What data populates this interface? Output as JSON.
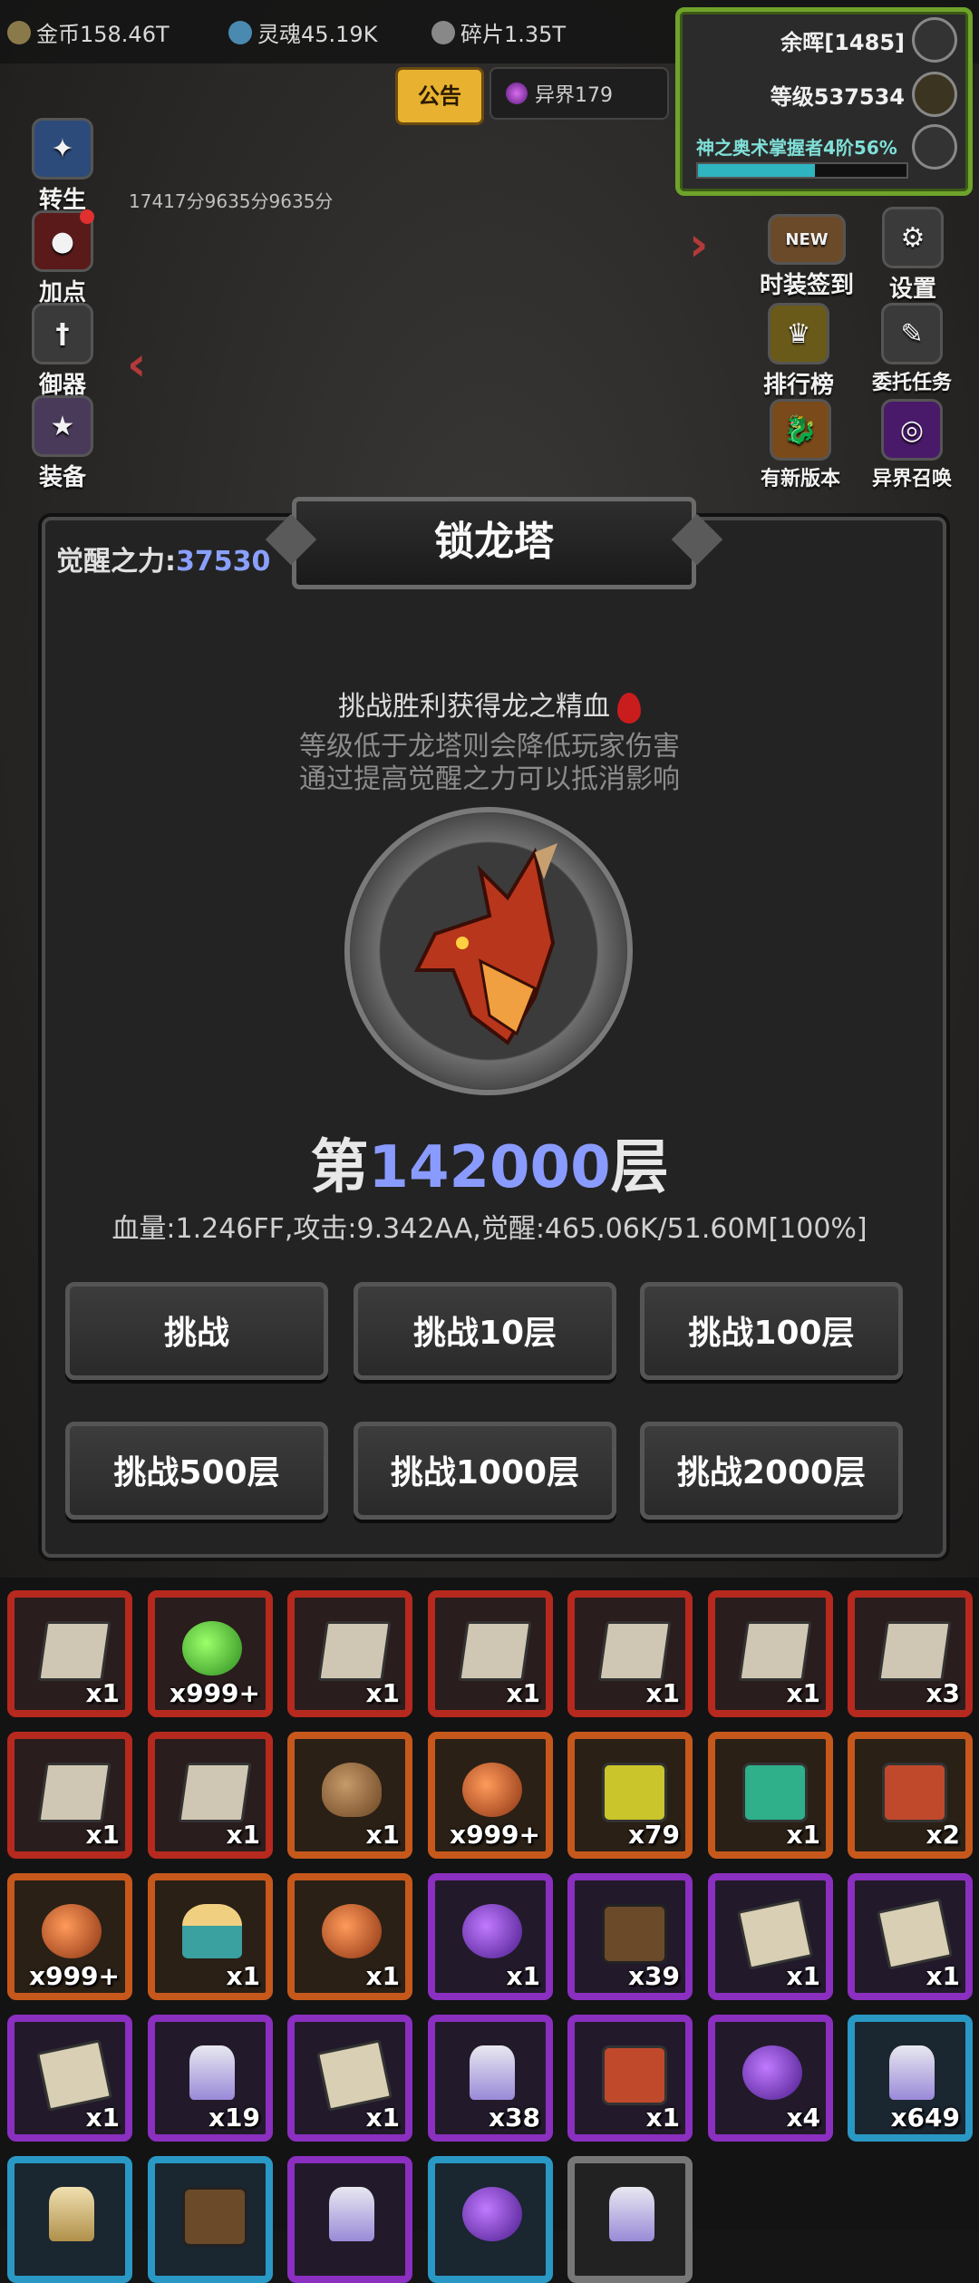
{
  "resources": {
    "gold": "金币158.46T",
    "soul": "灵魂45.19K",
    "shard": "碎片1.35T"
  },
  "top_panel": {
    "glory": "余晖[1485]",
    "level": "等级537534",
    "mastery": "神之奥术掌握者4阶56%",
    "mastery_progress": 0.56
  },
  "notice_label": "公告",
  "realm_label": "异界179",
  "score_text": "17417分9635分9635分",
  "side_left": [
    {
      "label": "转生",
      "icon": "rebirth-icon"
    },
    {
      "label": "加点",
      "icon": "potion-icon"
    },
    {
      "label": "御器",
      "icon": "sword-icon"
    },
    {
      "label": "装备",
      "icon": "shield-icon"
    }
  ],
  "side_right": [
    {
      "label": "时装签到",
      "icon": "new-icon"
    },
    {
      "label": "设置",
      "icon": "gear-icon"
    },
    {
      "label": "排行榜",
      "icon": "trophy-icon"
    },
    {
      "label": "委托任务",
      "icon": "quest-icon"
    },
    {
      "label": "有新版本",
      "icon": "dragon-icon"
    },
    {
      "label": "异界召唤",
      "icon": "portal-icon"
    }
  ],
  "modal": {
    "title": "锁龙塔",
    "awaken_label": "觉醒之力:",
    "awaken_value": "37530",
    "desc1": "挑战胜利获得龙之精血",
    "desc2": "等级低于龙塔则会降低玩家伤害",
    "desc3": "通过提高觉醒之力可以抵消影响",
    "floor_prefix": "第",
    "floor_number": "142000",
    "floor_suffix": "层",
    "stats": "血量:1.246FF,攻击:9.342AA,觉醒:465.06K/51.60M[100%]",
    "buttons": [
      "挑战",
      "挑战10层",
      "挑战100层",
      "挑战500层",
      "挑战1000层",
      "挑战2000层"
    ]
  },
  "inventory": [
    {
      "rarity": "red",
      "art": "box",
      "qty": "x1"
    },
    {
      "rarity": "red",
      "art": "bag-green",
      "qty": "x999+"
    },
    {
      "rarity": "red",
      "art": "box",
      "qty": "x1"
    },
    {
      "rarity": "red",
      "art": "box",
      "qty": "x1"
    },
    {
      "rarity": "red",
      "art": "box",
      "qty": "x1"
    },
    {
      "rarity": "red",
      "art": "box",
      "qty": "x1"
    },
    {
      "rarity": "red",
      "art": "box",
      "qty": "x3"
    },
    {
      "rarity": "red",
      "art": "box",
      "qty": "x1"
    },
    {
      "rarity": "red",
      "art": "box",
      "qty": "x1"
    },
    {
      "rarity": "orange",
      "art": "bag-brown",
      "qty": "x1"
    },
    {
      "rarity": "orange",
      "art": "bag-orange",
      "qty": "x999+"
    },
    {
      "rarity": "orange",
      "art": "chest-yellow",
      "qty": "x79"
    },
    {
      "rarity": "orange",
      "art": "chest-teal",
      "qty": "x1"
    },
    {
      "rarity": "orange",
      "art": "chest-red",
      "qty": "x2"
    },
    {
      "rarity": "orange",
      "art": "bag-orange",
      "qty": "x999+"
    },
    {
      "rarity": "orange",
      "art": "flask",
      "qty": "x1"
    },
    {
      "rarity": "orange",
      "art": "bag-orange",
      "qty": "x1"
    },
    {
      "rarity": "purple",
      "art": "bag-purple",
      "qty": "x1"
    },
    {
      "rarity": "purple",
      "art": "tools",
      "qty": "x39"
    },
    {
      "rarity": "purple",
      "art": "scroll",
      "qty": "x1"
    },
    {
      "rarity": "purple",
      "art": "scroll",
      "qty": "x1"
    },
    {
      "rarity": "purple",
      "art": "scroll",
      "qty": "x1"
    },
    {
      "rarity": "purple",
      "art": "vial",
      "qty": "x19"
    },
    {
      "rarity": "purple",
      "art": "scroll",
      "qty": "x1"
    },
    {
      "rarity": "purple",
      "art": "vial",
      "qty": "x38"
    },
    {
      "rarity": "purple",
      "art": "chest-red",
      "qty": "x1"
    },
    {
      "rarity": "purple",
      "art": "bag-purple",
      "qty": "x4"
    },
    {
      "rarity": "cyan",
      "art": "vial",
      "qty": "x649"
    },
    {
      "rarity": "cyan",
      "art": "vial-gold",
      "qty": ""
    },
    {
      "rarity": "cyan",
      "art": "tools",
      "qty": ""
    },
    {
      "rarity": "purple",
      "art": "vial",
      "qty": ""
    },
    {
      "rarity": "cyan",
      "art": "bag-purple",
      "qty": ""
    },
    {
      "rarity": "grey",
      "art": "vial",
      "qty": ""
    }
  ],
  "colors": {
    "accent_blue": "#8a9bff",
    "panel_green": "#6fa32b",
    "notice_gold": "#e8b230"
  }
}
